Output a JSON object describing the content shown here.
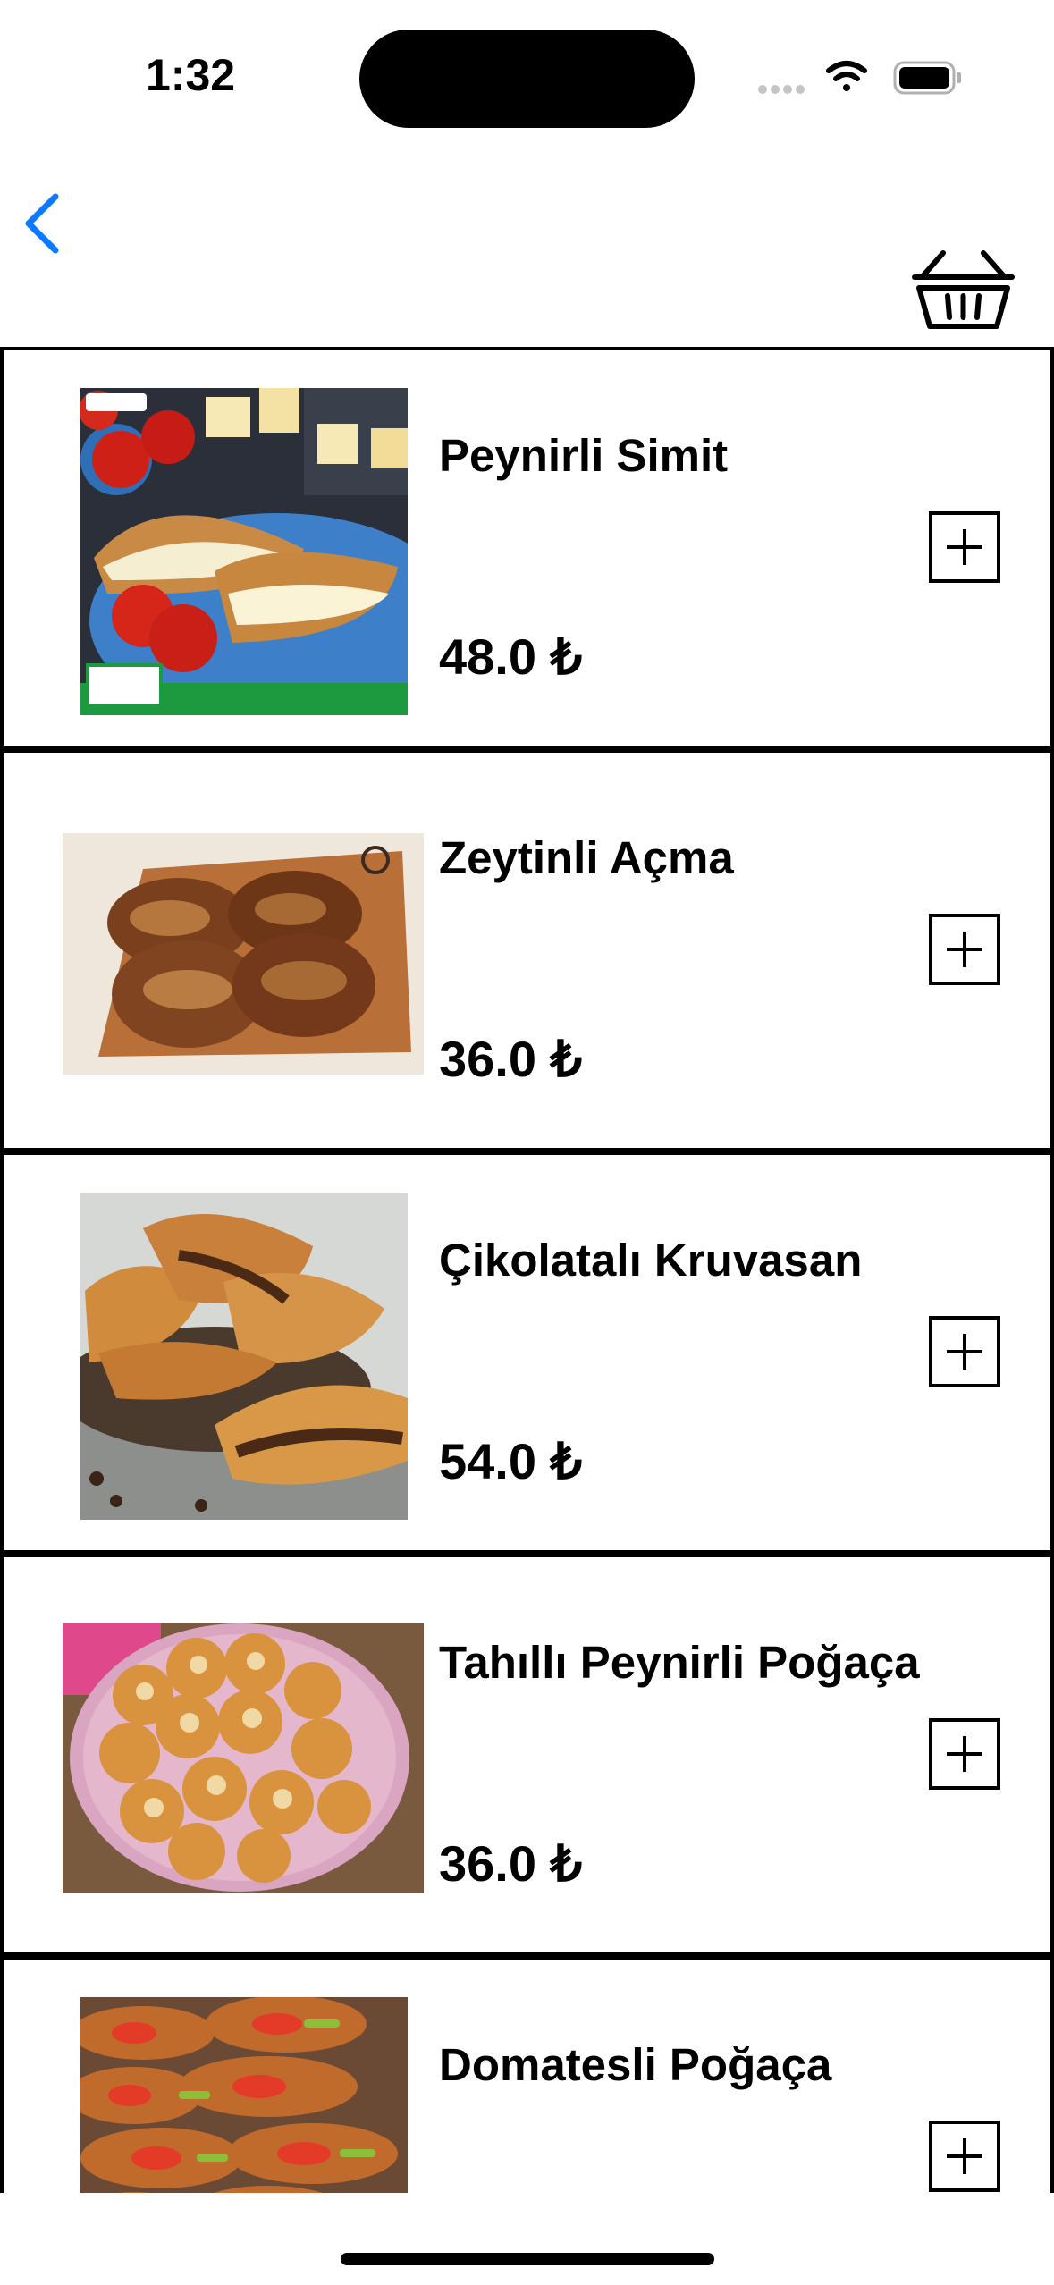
{
  "status_bar": {
    "time": "1:32"
  },
  "products": [
    {
      "name": "Peynirli Simit",
      "price": "48.0 ₺",
      "image": "sesame-bagel-with-cheese-photo"
    },
    {
      "name": "Zeytinli Açma",
      "price": "36.0 ₺",
      "image": "olive-pastry-on-board-photo"
    },
    {
      "name": "Çikolatalı Kruvasan",
      "price": "54.0 ₺",
      "image": "chocolate-croissants-photo"
    },
    {
      "name": "Tahıllı Peynirli Poğaça",
      "price": "36.0 ₺",
      "image": "seeded-cheese-buns-photo"
    },
    {
      "name": "Domatesli Poğaça",
      "price": "",
      "image": "tomato-pastries-photo"
    }
  ],
  "colors": {
    "accent": "#0A7AFF",
    "border": "#000000",
    "background": "#FFFFFF"
  },
  "icons": {
    "back": "chevron-left-icon",
    "basket": "basket-icon",
    "add": "plus-icon"
  }
}
